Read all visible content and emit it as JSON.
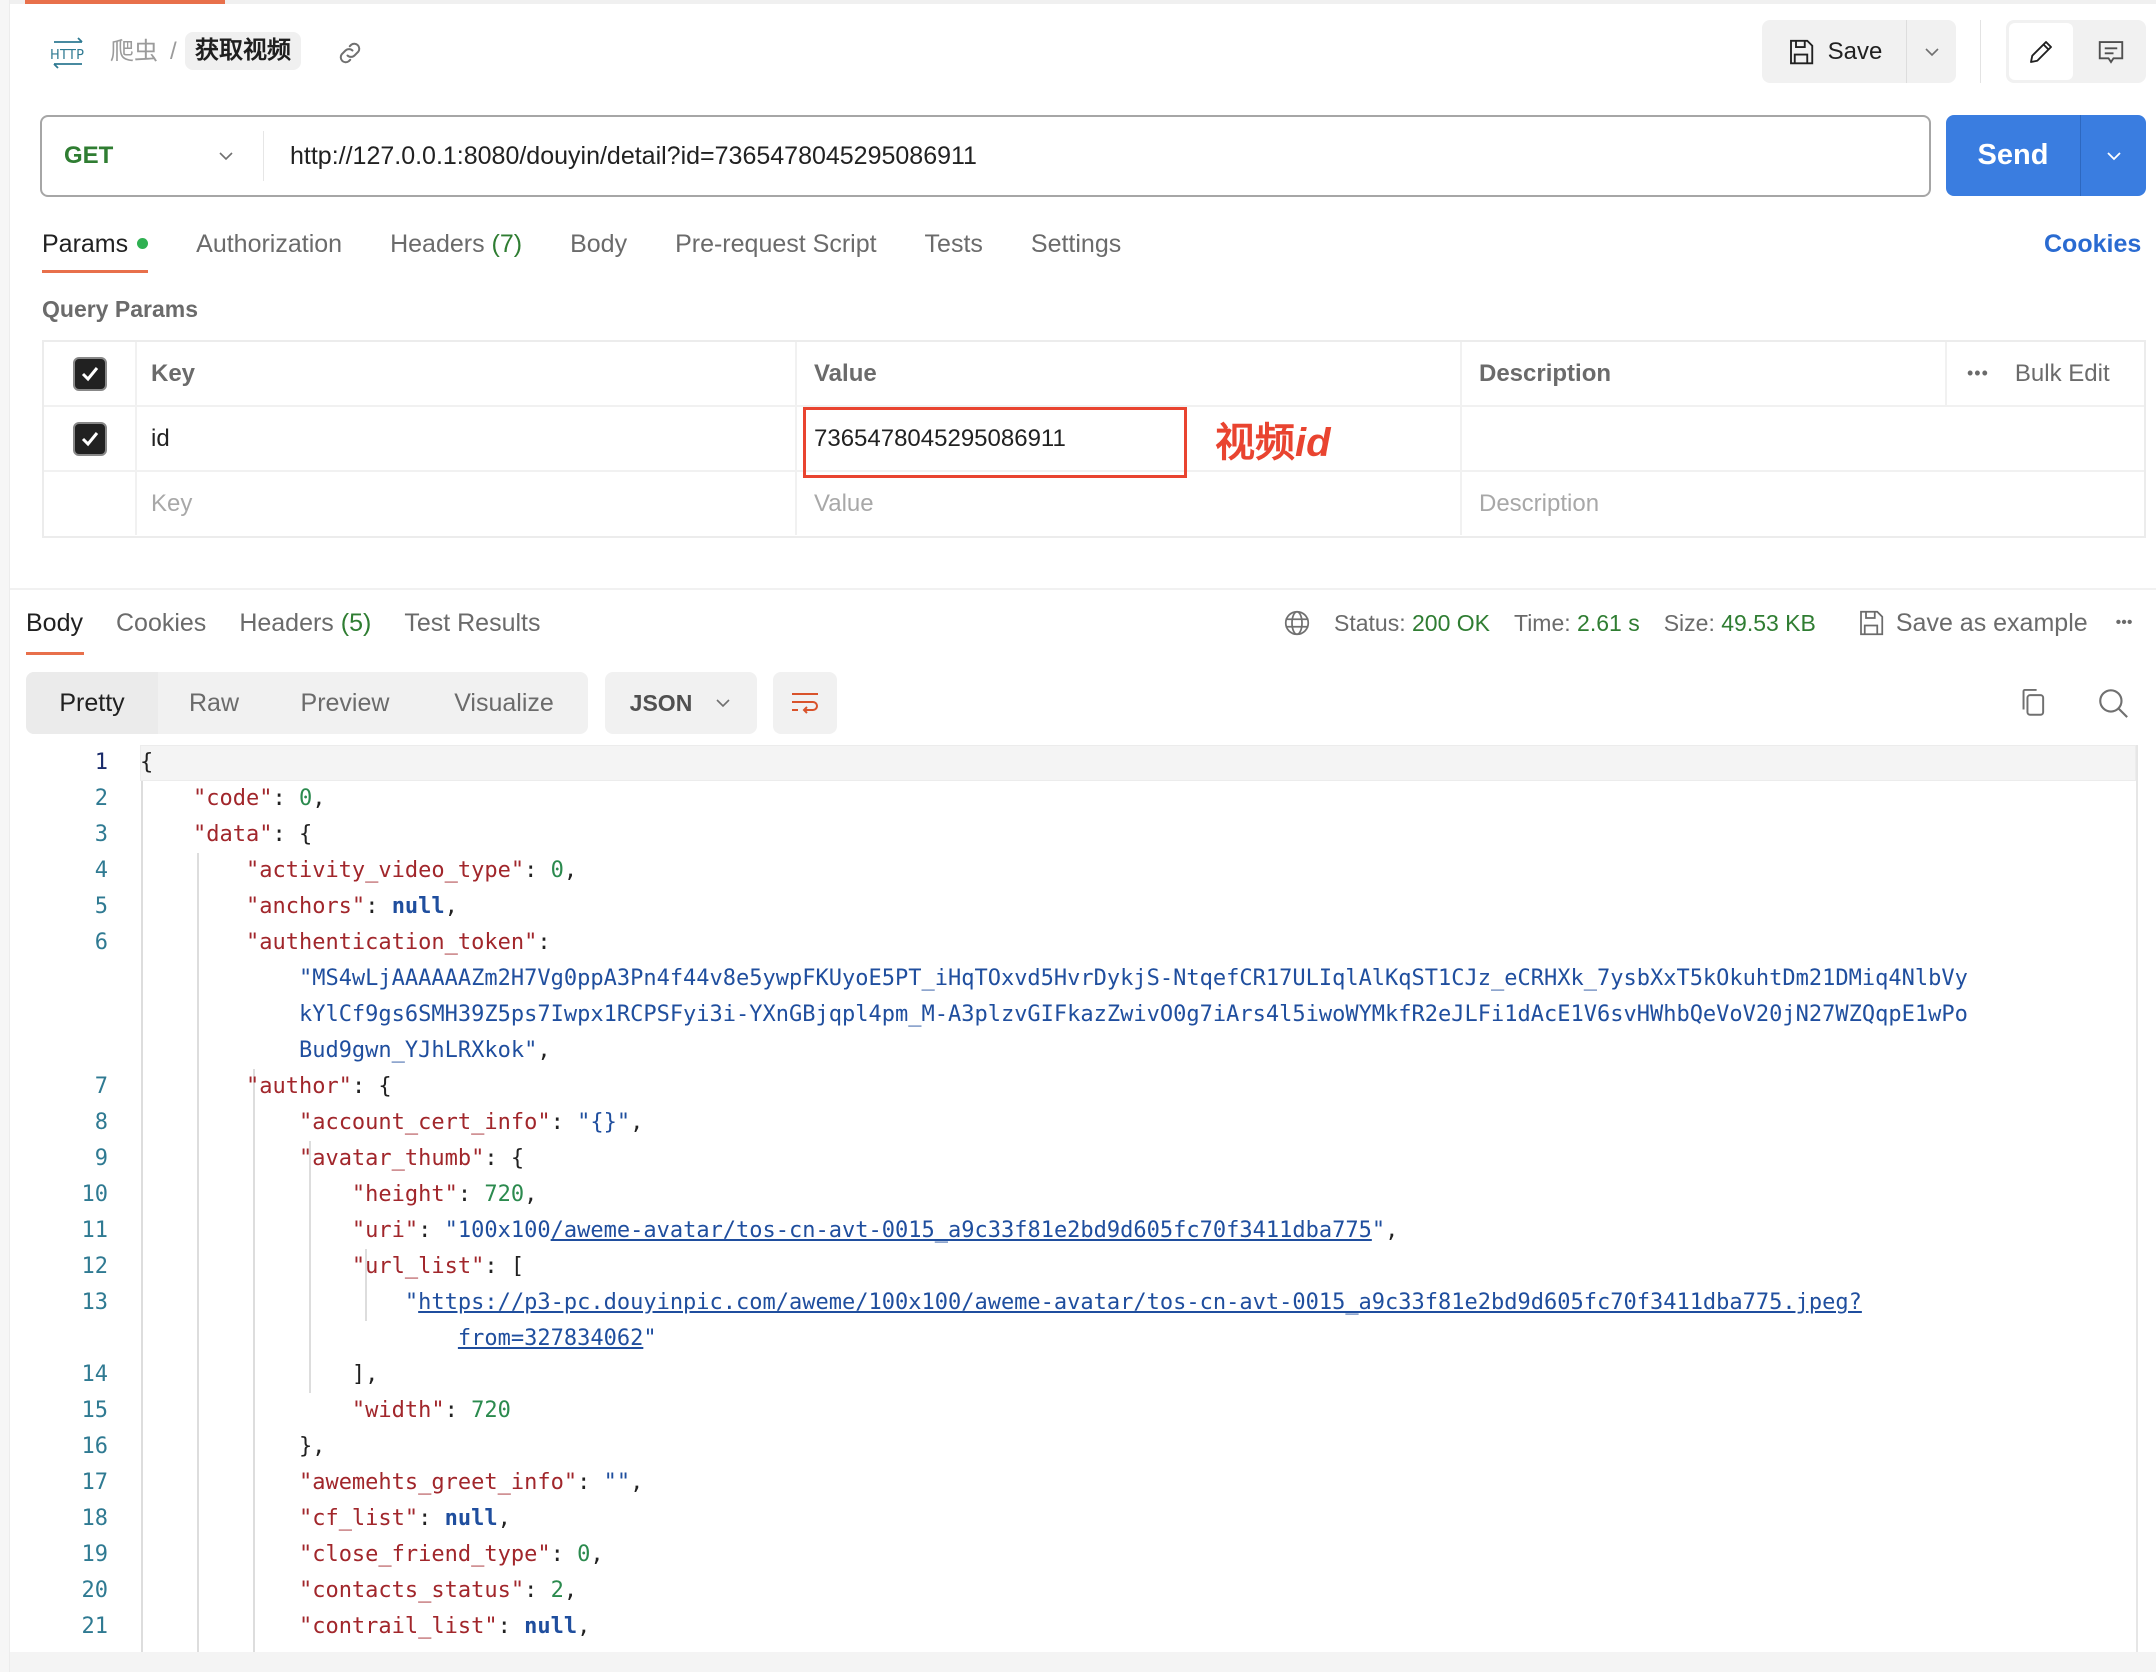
{
  "breadcrumb": {
    "protocol_icon": "http-icon",
    "collection": "爬虫",
    "separator": "/",
    "request_name": "获取视频"
  },
  "toolbar": {
    "save_label": "Save"
  },
  "request": {
    "method": "GET",
    "url": "http://127.0.0.1:8080/douyin/detail?id=7365478045295086911",
    "send_label": "Send"
  },
  "request_tabs": [
    {
      "label": "Params",
      "active": true,
      "dot": true
    },
    {
      "label": "Authorization"
    },
    {
      "label": "Headers",
      "count": "(7)"
    },
    {
      "label": "Body"
    },
    {
      "label": "Pre-request Script"
    },
    {
      "label": "Tests"
    },
    {
      "label": "Settings"
    }
  ],
  "cookies_link": "Cookies",
  "query_params": {
    "title": "Query Params",
    "headers": {
      "key": "Key",
      "value": "Value",
      "description": "Description",
      "bulk_edit": "Bulk Edit"
    },
    "rows": [
      {
        "checked": true,
        "key": "id",
        "value": "7365478045295086911",
        "description": ""
      }
    ],
    "placeholders": {
      "key": "Key",
      "value": "Value",
      "description": "Description"
    }
  },
  "annotation": {
    "label_cn": "视频",
    "label_en": "id",
    "color": "#e94430"
  },
  "response_tabs": [
    {
      "label": "Body",
      "active": true
    },
    {
      "label": "Cookies"
    },
    {
      "label": "Headers",
      "count": "(5)"
    },
    {
      "label": "Test Results"
    }
  ],
  "response_status": {
    "status_label": "Status:",
    "status_value": "200 OK",
    "time_label": "Time:",
    "time_value": "2.61 s",
    "size_label": "Size:",
    "size_value": "49.53 KB",
    "save_example": "Save as example"
  },
  "view_modes": [
    "Pretty",
    "Raw",
    "Preview",
    "Visualize"
  ],
  "format": "JSON",
  "code_lines": [
    {
      "n": "1",
      "html": "{"
    },
    {
      "n": "2",
      "html": "    <span class='k'>\"code\"</span>: <span class='n'>0</span>,"
    },
    {
      "n": "3",
      "html": "    <span class='k'>\"data\"</span>: {"
    },
    {
      "n": "4",
      "html": "        <span class='k'>\"activity_video_type\"</span>: <span class='n'>0</span>,"
    },
    {
      "n": "5",
      "html": "        <span class='k'>\"anchors\"</span>: <span class='nl'>null</span>,"
    },
    {
      "n": "6",
      "html": "        <span class='k'>\"authentication_token\"</span>:"
    },
    {
      "n": "",
      "html": "            <span class='s'>\"MS4wLjAAAAAAZm2H7Vg0ppA3Pn4f44v8e5ywpFKUyoE5PT_iHqTOxvd5HvrDykjS-NtqefCR17ULIqlAlKqST1CJz_eCRHXk_7ysbXxT5kOkuhtDm21DMiq4NlbVy</span>"
    },
    {
      "n": "",
      "html": "            <span class='s'>kYlCf9gs6SMH39Z5ps7Iwpx1RCPSFyi3i-YXnGBjqpl4pm_M-A3plzvGIFkazZwivO0g7iArs4l5iwoWYMkfR2eJLFi1dAcE1V6svHWhbQeVoV20jN27WZQqpE1wPo</span>"
    },
    {
      "n": "",
      "html": "            <span class='s'>Bud9gwn_YJhLRXkok\"</span>,"
    },
    {
      "n": "7",
      "html": "        <span class='k'>\"author\"</span>: {"
    },
    {
      "n": "8",
      "html": "            <span class='k'>\"account_cert_info\"</span>: <span class='s'>\"{}\"</span>,"
    },
    {
      "n": "9",
      "html": "            <span class='k'>\"avatar_thumb\"</span>: {"
    },
    {
      "n": "10",
      "html": "                <span class='k'>\"height\"</span>: <span class='n'>720</span>,"
    },
    {
      "n": "11",
      "html": "                <span class='k'>\"uri\"</span>: <span class='s'>\"100x100<span class='u'>/aweme-avatar/tos-cn-avt-0015_a9c33f81e2bd9d605fc70f3411dba775</span>\"</span>,"
    },
    {
      "n": "12",
      "html": "                <span class='k'>\"url_list\"</span>: ["
    },
    {
      "n": "13",
      "html": "                    <span class='s'>\"<span class='u'>https://p3-pc.douyinpic.com/aweme/100x100/aweme-avatar/tos-cn-avt-0015_a9c33f81e2bd9d605fc70f3411dba775.jpeg?</span></span>"
    },
    {
      "n": "",
      "html": "                        <span class='s'><span class='u'>from=327834062</span>\"</span>"
    },
    {
      "n": "14",
      "html": "                ],"
    },
    {
      "n": "15",
      "html": "                <span class='k'>\"width\"</span>: <span class='n'>720</span>"
    },
    {
      "n": "16",
      "html": "            },"
    },
    {
      "n": "17",
      "html": "            <span class='k'>\"awemehts_greet_info\"</span>: <span class='s'>\"\"</span>,"
    },
    {
      "n": "18",
      "html": "            <span class='k'>\"cf_list\"</span>: <span class='nl'>null</span>,"
    },
    {
      "n": "19",
      "html": "            <span class='k'>\"close_friend_type\"</span>: <span class='n'>0</span>,"
    },
    {
      "n": "20",
      "html": "            <span class='k'>\"contacts_status\"</span>: <span class='n'>2</span>,"
    },
    {
      "n": "21",
      "html": "            <span class='k'>\"contrail_list\"</span>: <span class='nl'>null</span>,"
    }
  ]
}
